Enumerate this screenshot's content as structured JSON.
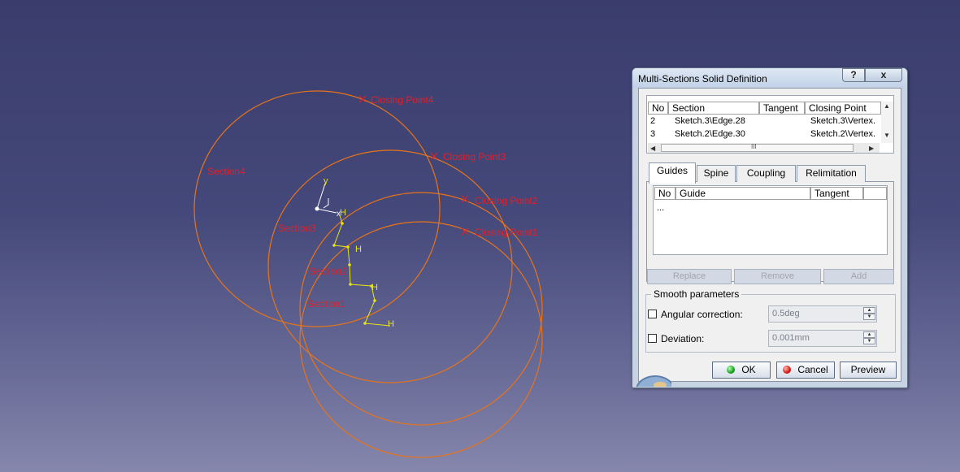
{
  "viewport": {
    "section_labels": [
      "Section4",
      "Section3",
      "Section2",
      "Section1"
    ],
    "closing_point_labels": [
      "Closing Point4",
      "Closing Point3",
      "Closing Point2",
      "Closing Point1"
    ],
    "axis_labels": {
      "y": "y",
      "x": "x"
    },
    "h_labels": [
      "H",
      "H",
      "H",
      "H"
    ],
    "colors": {
      "curve": "#e8731a",
      "label": "#e0202a",
      "sketch": "#e8e418",
      "axis": "#ffffff"
    }
  },
  "dialog": {
    "title": "Multi-Sections Solid Definition",
    "help_label": "?",
    "close_label": "x",
    "sections_table": {
      "headers": [
        "No",
        "Section",
        "Tangent",
        "Closing Point"
      ],
      "rows": [
        [
          "2",
          "Sketch.3\\Edge.28",
          "",
          "Sketch.3\\Vertex."
        ],
        [
          "3",
          "Sketch.2\\Edge.30",
          "",
          "Sketch.2\\Vertex."
        ]
      ],
      "hscroll_thumb": "III"
    },
    "tabs": [
      "Guides",
      "Spine",
      "Coupling",
      "Relimitation"
    ],
    "active_tab": "Guides",
    "guides_table": {
      "headers": [
        "No",
        "Guide",
        "Tangent"
      ],
      "rows": [
        [
          "..."
        ]
      ]
    },
    "action_buttons": [
      "Replace",
      "Remove",
      "Add"
    ],
    "smooth": {
      "title": "Smooth parameters",
      "angular_label": "Angular correction:",
      "angular_value": "0.5deg",
      "angular_checked": false,
      "deviation_label": "Deviation:",
      "deviation_value": "0.001mm",
      "deviation_checked": false
    },
    "ok_label": "OK",
    "cancel_label": "Cancel",
    "preview_label": "Preview"
  }
}
